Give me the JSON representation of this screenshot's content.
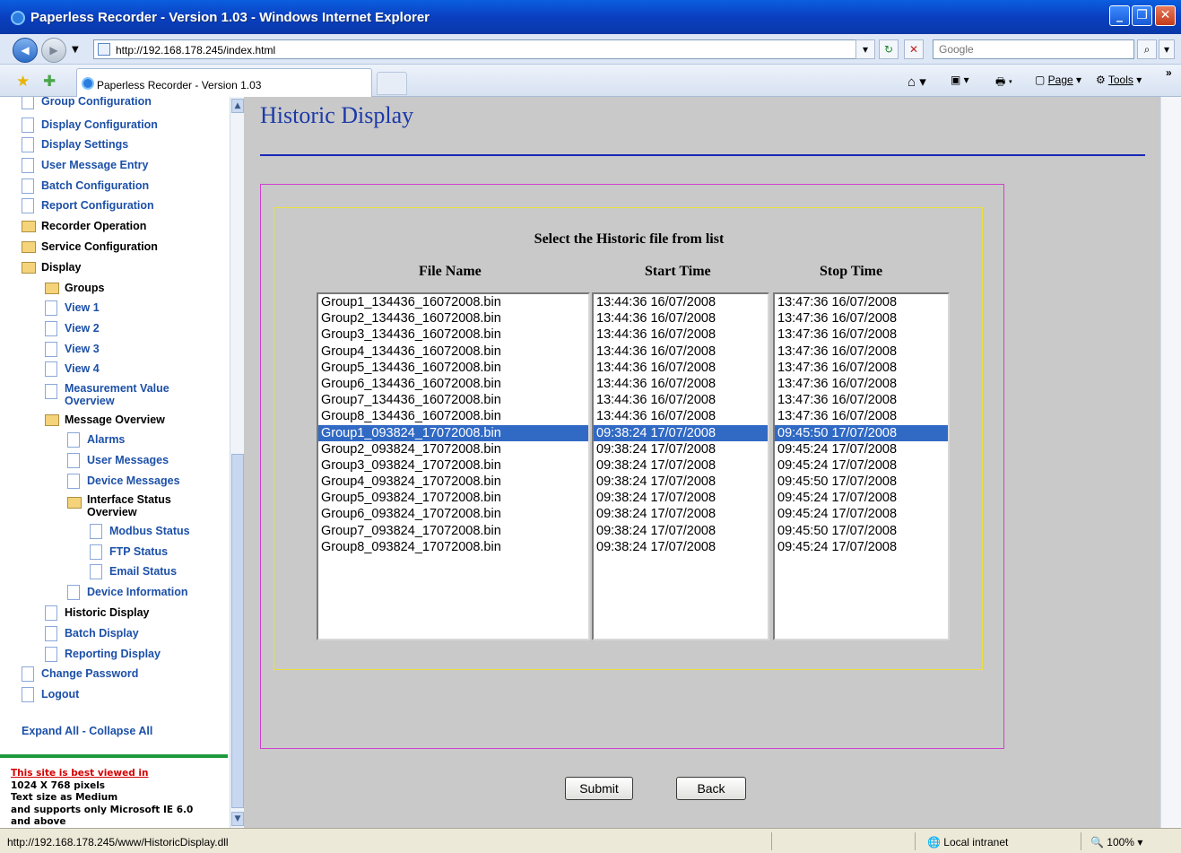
{
  "window": {
    "title": "Paperless Recorder - Version 1.03 - Windows Internet Explorer"
  },
  "address": {
    "url": "http://192.168.178.245/index.html",
    "search_placeholder": "Google"
  },
  "tabs": {
    "active_label": "Paperless Recorder - Version 1.03"
  },
  "commands": {
    "page": "Page",
    "tools": "Tools"
  },
  "sidebar": {
    "items": [
      {
        "label": "Group Configuration"
      },
      {
        "label": "Display Configuration"
      },
      {
        "label": "Display Settings"
      },
      {
        "label": "User Message Entry"
      },
      {
        "label": "Batch Configuration"
      },
      {
        "label": "Report Configuration"
      },
      {
        "label": "Recorder Operation"
      },
      {
        "label": "Service Configuration"
      },
      {
        "label": "Display"
      },
      {
        "label": "Groups"
      },
      {
        "label": "View 1"
      },
      {
        "label": "View 2"
      },
      {
        "label": "View 3"
      },
      {
        "label": "View 4"
      },
      {
        "label": "Measurement Value Overview"
      },
      {
        "label": "Message Overview"
      },
      {
        "label": "Alarms"
      },
      {
        "label": "User Messages"
      },
      {
        "label": "Device Messages"
      },
      {
        "label": "Interface Status Overview"
      },
      {
        "label": "Modbus Status"
      },
      {
        "label": "FTP Status"
      },
      {
        "label": "Email Status"
      },
      {
        "label": "Device Information"
      },
      {
        "label": "Historic Display"
      },
      {
        "label": "Batch Display"
      },
      {
        "label": "Reporting Display"
      },
      {
        "label": "Change Password"
      },
      {
        "label": "Logout"
      }
    ],
    "expand_collapse": "Expand All - Collapse All",
    "note_link": "This site is best viewed in",
    "note_line1": "1024 X 768 pixels",
    "note_line2": "Text size as Medium",
    "note_line3": "and supports only Microsoft IE 6.0",
    "note_line4": "and above"
  },
  "main": {
    "title": "Historic Display",
    "caption": "Select the Historic file from list",
    "headers": {
      "file": "File Name",
      "start": "Start Time",
      "stop": "Stop Time"
    },
    "files": [
      "Group1_134436_16072008.bin",
      "Group2_134436_16072008.bin",
      "Group3_134436_16072008.bin",
      "Group4_134436_16072008.bin",
      "Group5_134436_16072008.bin",
      "Group6_134436_16072008.bin",
      "Group7_134436_16072008.bin",
      "Group8_134436_16072008.bin",
      "Group1_093824_17072008.bin",
      "Group2_093824_17072008.bin",
      "Group3_093824_17072008.bin",
      "Group4_093824_17072008.bin",
      "Group5_093824_17072008.bin",
      "Group6_093824_17072008.bin",
      "Group7_093824_17072008.bin",
      "Group8_093824_17072008.bin"
    ],
    "starts": [
      "13:44:36 16/07/2008",
      "13:44:36 16/07/2008",
      "13:44:36 16/07/2008",
      "13:44:36 16/07/2008",
      "13:44:36 16/07/2008",
      "13:44:36 16/07/2008",
      "13:44:36 16/07/2008",
      "13:44:36 16/07/2008",
      "09:38:24 17/07/2008",
      "09:38:24 17/07/2008",
      "09:38:24 17/07/2008",
      "09:38:24 17/07/2008",
      "09:38:24 17/07/2008",
      "09:38:24 17/07/2008",
      "09:38:24 17/07/2008",
      "09:38:24 17/07/2008"
    ],
    "stops": [
      "13:47:36 16/07/2008",
      "13:47:36 16/07/2008",
      "13:47:36 16/07/2008",
      "13:47:36 16/07/2008",
      "13:47:36 16/07/2008",
      "13:47:36 16/07/2008",
      "13:47:36 16/07/2008",
      "13:47:36 16/07/2008",
      "09:45:50 17/07/2008",
      "09:45:24 17/07/2008",
      "09:45:24 17/07/2008",
      "09:45:50 17/07/2008",
      "09:45:24 17/07/2008",
      "09:45:24 17/07/2008",
      "09:45:50 17/07/2008",
      "09:45:24 17/07/2008"
    ],
    "selected_index": 8,
    "submit": "Submit",
    "back": "Back"
  },
  "status": {
    "text": "http://192.168.178.245/www/HistoricDisplay.dll",
    "zone": "Local intranet",
    "zoom": "100%"
  }
}
